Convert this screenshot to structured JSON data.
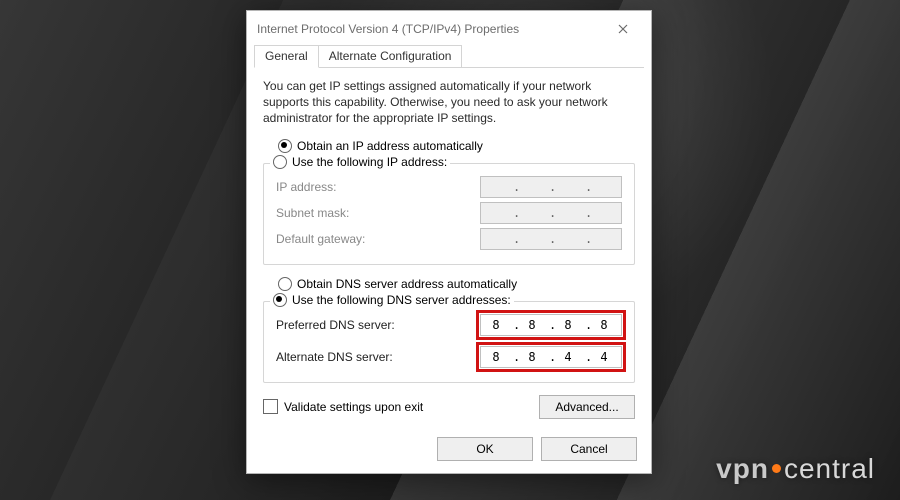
{
  "window": {
    "title": "Internet Protocol Version 4 (TCP/IPv4) Properties",
    "close_icon": "close-icon"
  },
  "tabs": [
    {
      "label": "General",
      "active": true
    },
    {
      "label": "Alternate Configuration",
      "active": false
    }
  ],
  "hint": "You can get IP settings assigned automatically if your network supports this capability. Otherwise, you need to ask your network administrator for the appropriate IP settings.",
  "ip_block": {
    "radio_auto": "Obtain an IP address automatically",
    "radio_manual": "Use the following IP address:",
    "selected": "auto",
    "fields": {
      "ip": {
        "label": "IP address:",
        "value": [
          "",
          "",
          "",
          ""
        ]
      },
      "mask": {
        "label": "Subnet mask:",
        "value": [
          "",
          "",
          "",
          ""
        ]
      },
      "gateway": {
        "label": "Default gateway:",
        "value": [
          "",
          "",
          "",
          ""
        ]
      }
    }
  },
  "dns_block": {
    "radio_auto": "Obtain DNS server address automatically",
    "radio_manual": "Use the following DNS server addresses:",
    "selected": "manual",
    "fields": {
      "preferred": {
        "label": "Preferred DNS server:",
        "value": [
          "8",
          "8",
          "8",
          "8"
        ],
        "highlight": true
      },
      "alternate": {
        "label": "Alternate DNS server:",
        "value": [
          "8",
          "8",
          "4",
          "4"
        ],
        "highlight": true
      }
    }
  },
  "validate": {
    "label": "Validate settings upon exit",
    "checked": false
  },
  "buttons": {
    "advanced": "Advanced...",
    "ok": "OK",
    "cancel": "Cancel"
  },
  "watermark": {
    "pre": "vpn",
    "post": "central"
  }
}
